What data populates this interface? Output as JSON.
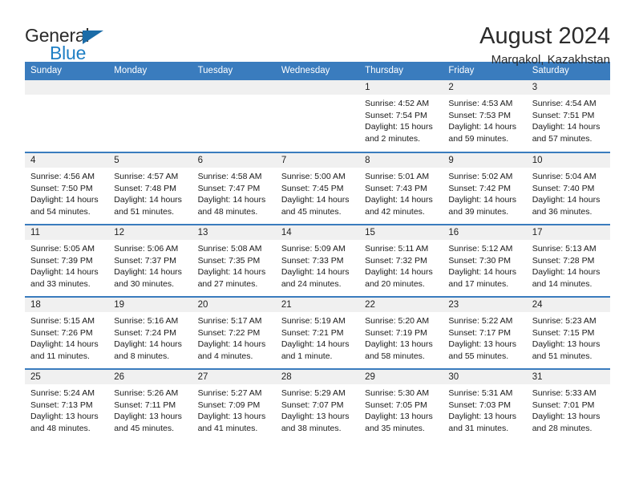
{
  "brand": {
    "word_one": "General",
    "word_two": "Blue",
    "flag_icon": "triangle-flag-icon"
  },
  "header": {
    "title": "August 2024",
    "location": "Marqakol, Kazakhstan"
  },
  "colors": {
    "header_blue": "#3a7cbe",
    "brand_blue": "#1f7fc4",
    "flag_blue": "#1b6ca8",
    "band_gray": "#f0f0f0"
  },
  "calendar": {
    "weekday_headers": [
      "Sunday",
      "Monday",
      "Tuesday",
      "Wednesday",
      "Thursday",
      "Friday",
      "Saturday"
    ],
    "weeks": [
      [
        {
          "day": "",
          "sunrise": "",
          "sunset": "",
          "daylight_1": "",
          "daylight_2": ""
        },
        {
          "day": "",
          "sunrise": "",
          "sunset": "",
          "daylight_1": "",
          "daylight_2": ""
        },
        {
          "day": "",
          "sunrise": "",
          "sunset": "",
          "daylight_1": "",
          "daylight_2": ""
        },
        {
          "day": "",
          "sunrise": "",
          "sunset": "",
          "daylight_1": "",
          "daylight_2": ""
        },
        {
          "day": "1",
          "sunrise": "Sunrise: 4:52 AM",
          "sunset": "Sunset: 7:54 PM",
          "daylight_1": "Daylight: 15 hours",
          "daylight_2": "and 2 minutes."
        },
        {
          "day": "2",
          "sunrise": "Sunrise: 4:53 AM",
          "sunset": "Sunset: 7:53 PM",
          "daylight_1": "Daylight: 14 hours",
          "daylight_2": "and 59 minutes."
        },
        {
          "day": "3",
          "sunrise": "Sunrise: 4:54 AM",
          "sunset": "Sunset: 7:51 PM",
          "daylight_1": "Daylight: 14 hours",
          "daylight_2": "and 57 minutes."
        }
      ],
      [
        {
          "day": "4",
          "sunrise": "Sunrise: 4:56 AM",
          "sunset": "Sunset: 7:50 PM",
          "daylight_1": "Daylight: 14 hours",
          "daylight_2": "and 54 minutes."
        },
        {
          "day": "5",
          "sunrise": "Sunrise: 4:57 AM",
          "sunset": "Sunset: 7:48 PM",
          "daylight_1": "Daylight: 14 hours",
          "daylight_2": "and 51 minutes."
        },
        {
          "day": "6",
          "sunrise": "Sunrise: 4:58 AM",
          "sunset": "Sunset: 7:47 PM",
          "daylight_1": "Daylight: 14 hours",
          "daylight_2": "and 48 minutes."
        },
        {
          "day": "7",
          "sunrise": "Sunrise: 5:00 AM",
          "sunset": "Sunset: 7:45 PM",
          "daylight_1": "Daylight: 14 hours",
          "daylight_2": "and 45 minutes."
        },
        {
          "day": "8",
          "sunrise": "Sunrise: 5:01 AM",
          "sunset": "Sunset: 7:43 PM",
          "daylight_1": "Daylight: 14 hours",
          "daylight_2": "and 42 minutes."
        },
        {
          "day": "9",
          "sunrise": "Sunrise: 5:02 AM",
          "sunset": "Sunset: 7:42 PM",
          "daylight_1": "Daylight: 14 hours",
          "daylight_2": "and 39 minutes."
        },
        {
          "day": "10",
          "sunrise": "Sunrise: 5:04 AM",
          "sunset": "Sunset: 7:40 PM",
          "daylight_1": "Daylight: 14 hours",
          "daylight_2": "and 36 minutes."
        }
      ],
      [
        {
          "day": "11",
          "sunrise": "Sunrise: 5:05 AM",
          "sunset": "Sunset: 7:39 PM",
          "daylight_1": "Daylight: 14 hours",
          "daylight_2": "and 33 minutes."
        },
        {
          "day": "12",
          "sunrise": "Sunrise: 5:06 AM",
          "sunset": "Sunset: 7:37 PM",
          "daylight_1": "Daylight: 14 hours",
          "daylight_2": "and 30 minutes."
        },
        {
          "day": "13",
          "sunrise": "Sunrise: 5:08 AM",
          "sunset": "Sunset: 7:35 PM",
          "daylight_1": "Daylight: 14 hours",
          "daylight_2": "and 27 minutes."
        },
        {
          "day": "14",
          "sunrise": "Sunrise: 5:09 AM",
          "sunset": "Sunset: 7:33 PM",
          "daylight_1": "Daylight: 14 hours",
          "daylight_2": "and 24 minutes."
        },
        {
          "day": "15",
          "sunrise": "Sunrise: 5:11 AM",
          "sunset": "Sunset: 7:32 PM",
          "daylight_1": "Daylight: 14 hours",
          "daylight_2": "and 20 minutes."
        },
        {
          "day": "16",
          "sunrise": "Sunrise: 5:12 AM",
          "sunset": "Sunset: 7:30 PM",
          "daylight_1": "Daylight: 14 hours",
          "daylight_2": "and 17 minutes."
        },
        {
          "day": "17",
          "sunrise": "Sunrise: 5:13 AM",
          "sunset": "Sunset: 7:28 PM",
          "daylight_1": "Daylight: 14 hours",
          "daylight_2": "and 14 minutes."
        }
      ],
      [
        {
          "day": "18",
          "sunrise": "Sunrise: 5:15 AM",
          "sunset": "Sunset: 7:26 PM",
          "daylight_1": "Daylight: 14 hours",
          "daylight_2": "and 11 minutes."
        },
        {
          "day": "19",
          "sunrise": "Sunrise: 5:16 AM",
          "sunset": "Sunset: 7:24 PM",
          "daylight_1": "Daylight: 14 hours",
          "daylight_2": "and 8 minutes."
        },
        {
          "day": "20",
          "sunrise": "Sunrise: 5:17 AM",
          "sunset": "Sunset: 7:22 PM",
          "daylight_1": "Daylight: 14 hours",
          "daylight_2": "and 4 minutes."
        },
        {
          "day": "21",
          "sunrise": "Sunrise: 5:19 AM",
          "sunset": "Sunset: 7:21 PM",
          "daylight_1": "Daylight: 14 hours",
          "daylight_2": "and 1 minute."
        },
        {
          "day": "22",
          "sunrise": "Sunrise: 5:20 AM",
          "sunset": "Sunset: 7:19 PM",
          "daylight_1": "Daylight: 13 hours",
          "daylight_2": "and 58 minutes."
        },
        {
          "day": "23",
          "sunrise": "Sunrise: 5:22 AM",
          "sunset": "Sunset: 7:17 PM",
          "daylight_1": "Daylight: 13 hours",
          "daylight_2": "and 55 minutes."
        },
        {
          "day": "24",
          "sunrise": "Sunrise: 5:23 AM",
          "sunset": "Sunset: 7:15 PM",
          "daylight_1": "Daylight: 13 hours",
          "daylight_2": "and 51 minutes."
        }
      ],
      [
        {
          "day": "25",
          "sunrise": "Sunrise: 5:24 AM",
          "sunset": "Sunset: 7:13 PM",
          "daylight_1": "Daylight: 13 hours",
          "daylight_2": "and 48 minutes."
        },
        {
          "day": "26",
          "sunrise": "Sunrise: 5:26 AM",
          "sunset": "Sunset: 7:11 PM",
          "daylight_1": "Daylight: 13 hours",
          "daylight_2": "and 45 minutes."
        },
        {
          "day": "27",
          "sunrise": "Sunrise: 5:27 AM",
          "sunset": "Sunset: 7:09 PM",
          "daylight_1": "Daylight: 13 hours",
          "daylight_2": "and 41 minutes."
        },
        {
          "day": "28",
          "sunrise": "Sunrise: 5:29 AM",
          "sunset": "Sunset: 7:07 PM",
          "daylight_1": "Daylight: 13 hours",
          "daylight_2": "and 38 minutes."
        },
        {
          "day": "29",
          "sunrise": "Sunrise: 5:30 AM",
          "sunset": "Sunset: 7:05 PM",
          "daylight_1": "Daylight: 13 hours",
          "daylight_2": "and 35 minutes."
        },
        {
          "day": "30",
          "sunrise": "Sunrise: 5:31 AM",
          "sunset": "Sunset: 7:03 PM",
          "daylight_1": "Daylight: 13 hours",
          "daylight_2": "and 31 minutes."
        },
        {
          "day": "31",
          "sunrise": "Sunrise: 5:33 AM",
          "sunset": "Sunset: 7:01 PM",
          "daylight_1": "Daylight: 13 hours",
          "daylight_2": "and 28 minutes."
        }
      ]
    ]
  }
}
